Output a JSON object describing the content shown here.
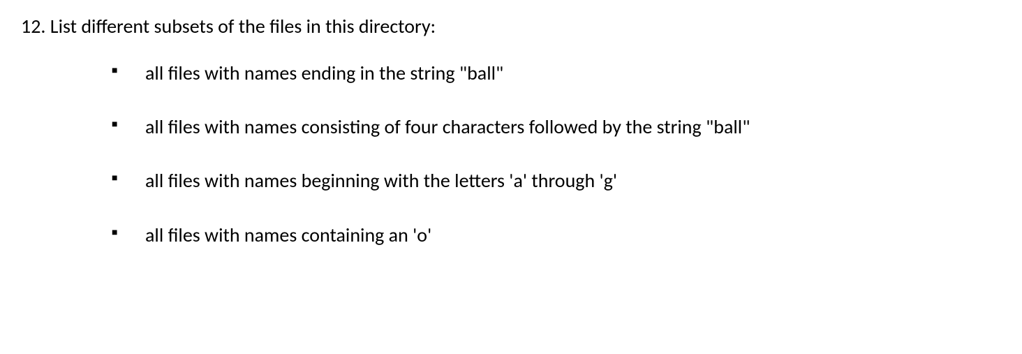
{
  "question": {
    "number": "12.",
    "text": "List different subsets of the files in this directory:"
  },
  "bullets": [
    "all files with names ending in the string \"ball\"",
    "all files with names consisting of four characters followed by the string \"ball\"",
    "all files with names beginning with the letters 'a' through 'g'",
    "all files with names containing an 'o'"
  ]
}
